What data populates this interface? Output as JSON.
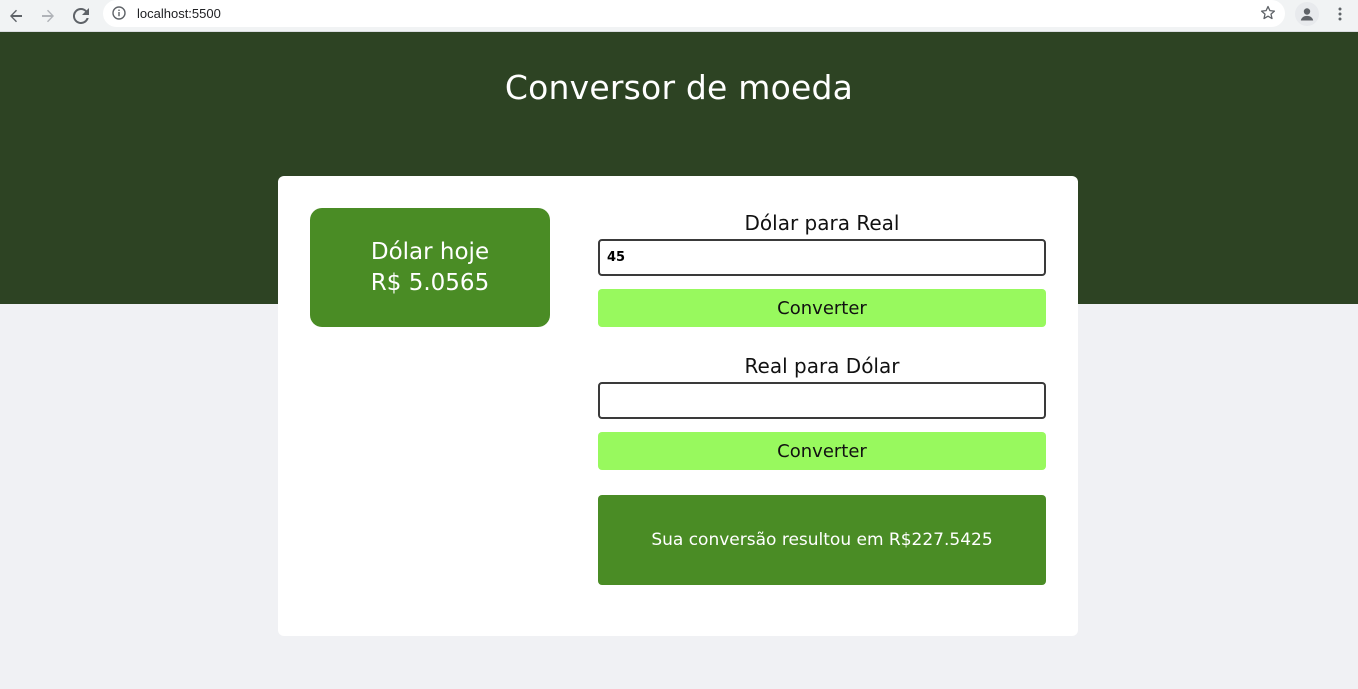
{
  "browser": {
    "url": "localhost:5500",
    "icons": {
      "back": "arrow-left-icon",
      "forward": "arrow-right-icon",
      "reload": "reload-icon",
      "info": "info-icon",
      "bookmark": "star-icon",
      "profile": "person-icon",
      "menu": "kebab-menu-icon"
    }
  },
  "page": {
    "title": "Conversor de moeda",
    "rate": {
      "label": "Dólar hoje",
      "value": "R$ 5.0565"
    },
    "usd_to_brl": {
      "label": "Dólar para Real",
      "input_value": "45",
      "button_label": "Converter"
    },
    "brl_to_usd": {
      "label": "Real para Dólar",
      "input_value": "",
      "button_label": "Converter"
    },
    "result": {
      "text": "Sua conversão resultou em R$227.5425"
    }
  },
  "colors": {
    "hero_bg": "#2d4323",
    "accent_green": "#4a8c25",
    "button_green": "#98f95e",
    "page_bg": "#f0f1f4"
  }
}
